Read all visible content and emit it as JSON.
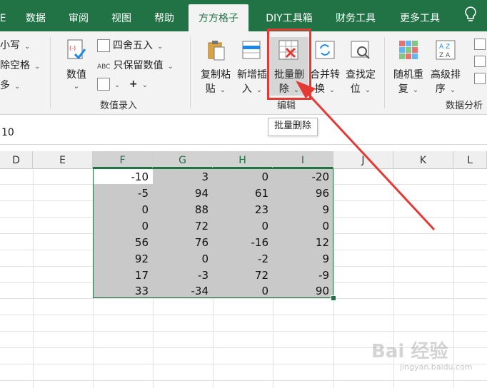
{
  "tabs": [
    {
      "label": "E"
    },
    {
      "label": "数据"
    },
    {
      "label": "审阅"
    },
    {
      "label": "视图"
    },
    {
      "label": "帮助"
    },
    {
      "label": "方方格子"
    },
    {
      "label": "DIY工具箱"
    },
    {
      "label": "财务工具"
    },
    {
      "label": "更多工具"
    }
  ],
  "ribbon": {
    "left_items": [
      "小写",
      "除空格",
      "多"
    ],
    "numeric_value_btn": {
      "line1": "数值",
      "line2": "⌄"
    },
    "round_btn": "四舍五入",
    "keep_values_btn": "只保留数值",
    "abc_label": "ABC",
    "group_numeric_label": "数值录入",
    "copy_paste_btn": {
      "line1": "复制粘",
      "line2": "贴"
    },
    "insert_btn": {
      "line1": "新增插",
      "line2": "入"
    },
    "batch_delete_btn": {
      "line1": "批量删",
      "line2": "除"
    },
    "merge_btn": {
      "line1": "合并转",
      "line2": "换"
    },
    "find_btn": {
      "line1": "查找定",
      "line2": "位"
    },
    "group_edit_label": "编辑",
    "random_btn": {
      "line1": "随机重",
      "line2": "复"
    },
    "sort_btn": {
      "line1": "高级排",
      "line2": "序"
    },
    "group_analysis_label": "数据分析",
    "tooltip": "批量删除"
  },
  "formula_bar": {
    "value": "10"
  },
  "columns": [
    "D",
    "E",
    "F",
    "G",
    "H",
    "I",
    "J",
    "K",
    "L"
  ],
  "table": [
    [
      "-10",
      "3",
      "0",
      "-20"
    ],
    [
      "-5",
      "94",
      "61",
      "96"
    ],
    [
      "0",
      "88",
      "23",
      "9"
    ],
    [
      "0",
      "72",
      "0",
      "0"
    ],
    [
      "56",
      "76",
      "-16",
      "12"
    ],
    [
      "92",
      "0",
      "-2",
      "9"
    ],
    [
      "17",
      "-3",
      "72",
      "-9"
    ],
    [
      "33",
      "-34",
      "0",
      "90"
    ]
  ],
  "watermark": {
    "main": "Bai 经验",
    "sub": "jingyan.baidu.com"
  },
  "colors": {
    "accent": "#217346",
    "highlight": "#e53935"
  }
}
